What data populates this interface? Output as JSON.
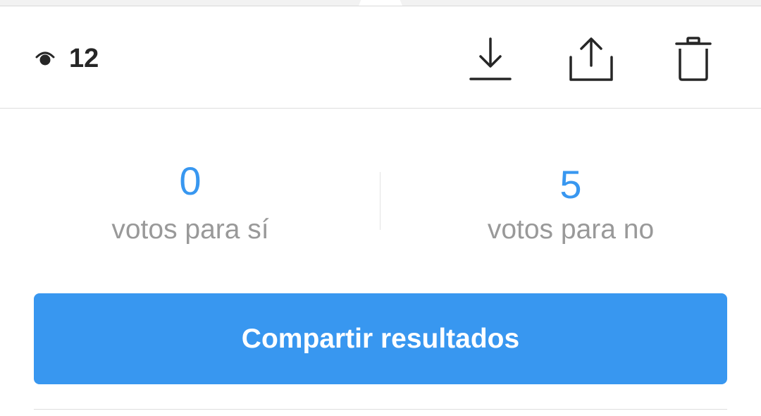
{
  "header": {
    "view_count": "12",
    "view_icon": "eye-icon",
    "actions": [
      {
        "name": "download",
        "icon": "download-icon"
      },
      {
        "name": "share",
        "icon": "share-icon"
      },
      {
        "name": "delete",
        "icon": "trash-icon"
      }
    ]
  },
  "results": {
    "yes": {
      "count": "0",
      "label": "votos para sí"
    },
    "no": {
      "count": "5",
      "label": "votos para no"
    }
  },
  "share_button": {
    "label": "Compartir resultados"
  },
  "colors": {
    "accent": "#3897f0",
    "label_gray": "#999999",
    "icon_dark": "#262626"
  }
}
